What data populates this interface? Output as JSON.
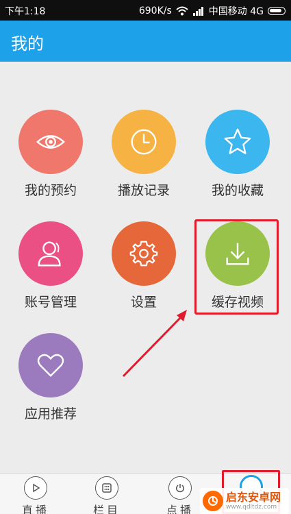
{
  "status": {
    "time": "下午1:18",
    "speed": "690K/s",
    "carrier": "中国移动 4G"
  },
  "header": {
    "title": "我的"
  },
  "grid": [
    {
      "label": "我的预约",
      "icon": "eye-icon",
      "color": "#f0776c"
    },
    {
      "label": "播放记录",
      "icon": "clock-icon",
      "color": "#f6b242"
    },
    {
      "label": "我的收藏",
      "icon": "star-icon",
      "color": "#3cb6ee"
    },
    {
      "label": "账号管理",
      "icon": "user-icon",
      "color": "#ea5084"
    },
    {
      "label": "设置",
      "icon": "gear-icon",
      "color": "#e5673a"
    },
    {
      "label": "缓存视频",
      "icon": "download-icon",
      "color": "#99c24a"
    },
    {
      "label": "应用推荐",
      "icon": "heart-icon",
      "color": "#9b7bbd"
    }
  ],
  "tabs": [
    {
      "label": "直播",
      "icon": "play-icon"
    },
    {
      "label": "栏目",
      "icon": "grid-icon"
    },
    {
      "label": "点播",
      "icon": "power-icon"
    }
  ],
  "watermark": {
    "name": "启东安卓网",
    "url": "www.qdltdz.com"
  }
}
